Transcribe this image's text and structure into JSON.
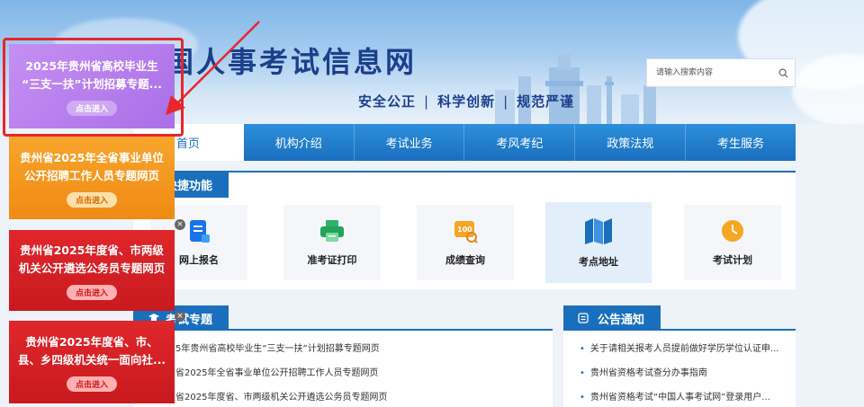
{
  "header": {
    "site_title": "国人事考试信息网",
    "slogan": [
      "安全公正",
      "科学创新",
      "规范严谨"
    ],
    "search_placeholder": "请输入搜索内容"
  },
  "nav": {
    "items": [
      "首页",
      "机构介绍",
      "考试业务",
      "考风考纪",
      "政策法规",
      "考生服务"
    ]
  },
  "quick": {
    "title": "快捷功能",
    "cards": [
      {
        "label": "网上报名",
        "icon": "online-register-icon"
      },
      {
        "label": "准考证打印",
        "icon": "printer-icon"
      },
      {
        "label": "成绩查询",
        "icon": "score-query-icon"
      },
      {
        "label": "考点地址",
        "icon": "map-icon"
      },
      {
        "label": "考试计划",
        "icon": "clock-icon"
      }
    ]
  },
  "topics": {
    "title": "考试专题",
    "links": [
      "5年贵州省高校毕业生“三支一扶”计划招募专题网页",
      "省2025年全省事业单位公开招聘工作人员专题网页",
      "省2025年度省、市两级机关公开遴选公务员专题网页"
    ]
  },
  "notices": {
    "title": "公告通知",
    "links": [
      "关于请相关报考人员提前做好学历学位认证申...",
      "贵州省资格考试查分办事指南",
      "贵州省资格考试“中国人事考试网”登录用户..."
    ]
  },
  "promos": [
    {
      "lines": [
        "2025年贵州省高校毕业生",
        "“三支一扶”计划招募专题..."
      ],
      "button": "点击进入"
    },
    {
      "lines": [
        "贵州省2025年全省事业单位",
        "公开招聘工作人员专题网页"
      ],
      "button": "点击进入"
    },
    {
      "lines": [
        "贵州省2025年度省、市两级",
        "机关公开遴选公务员专题网页"
      ],
      "button": "点击进入"
    },
    {
      "lines": [
        "贵州省2025年度省、市、",
        "县、乡四级机关统一面向社..."
      ],
      "button": "点击进入"
    }
  ],
  "colors": {
    "primary": "#1a6fbd",
    "title": "#1c3f8c",
    "highlight_frame": "#e8262b",
    "promo_purple": "#b47ded",
    "promo_orange": "#f39a20",
    "promo_red": "#d42126"
  }
}
